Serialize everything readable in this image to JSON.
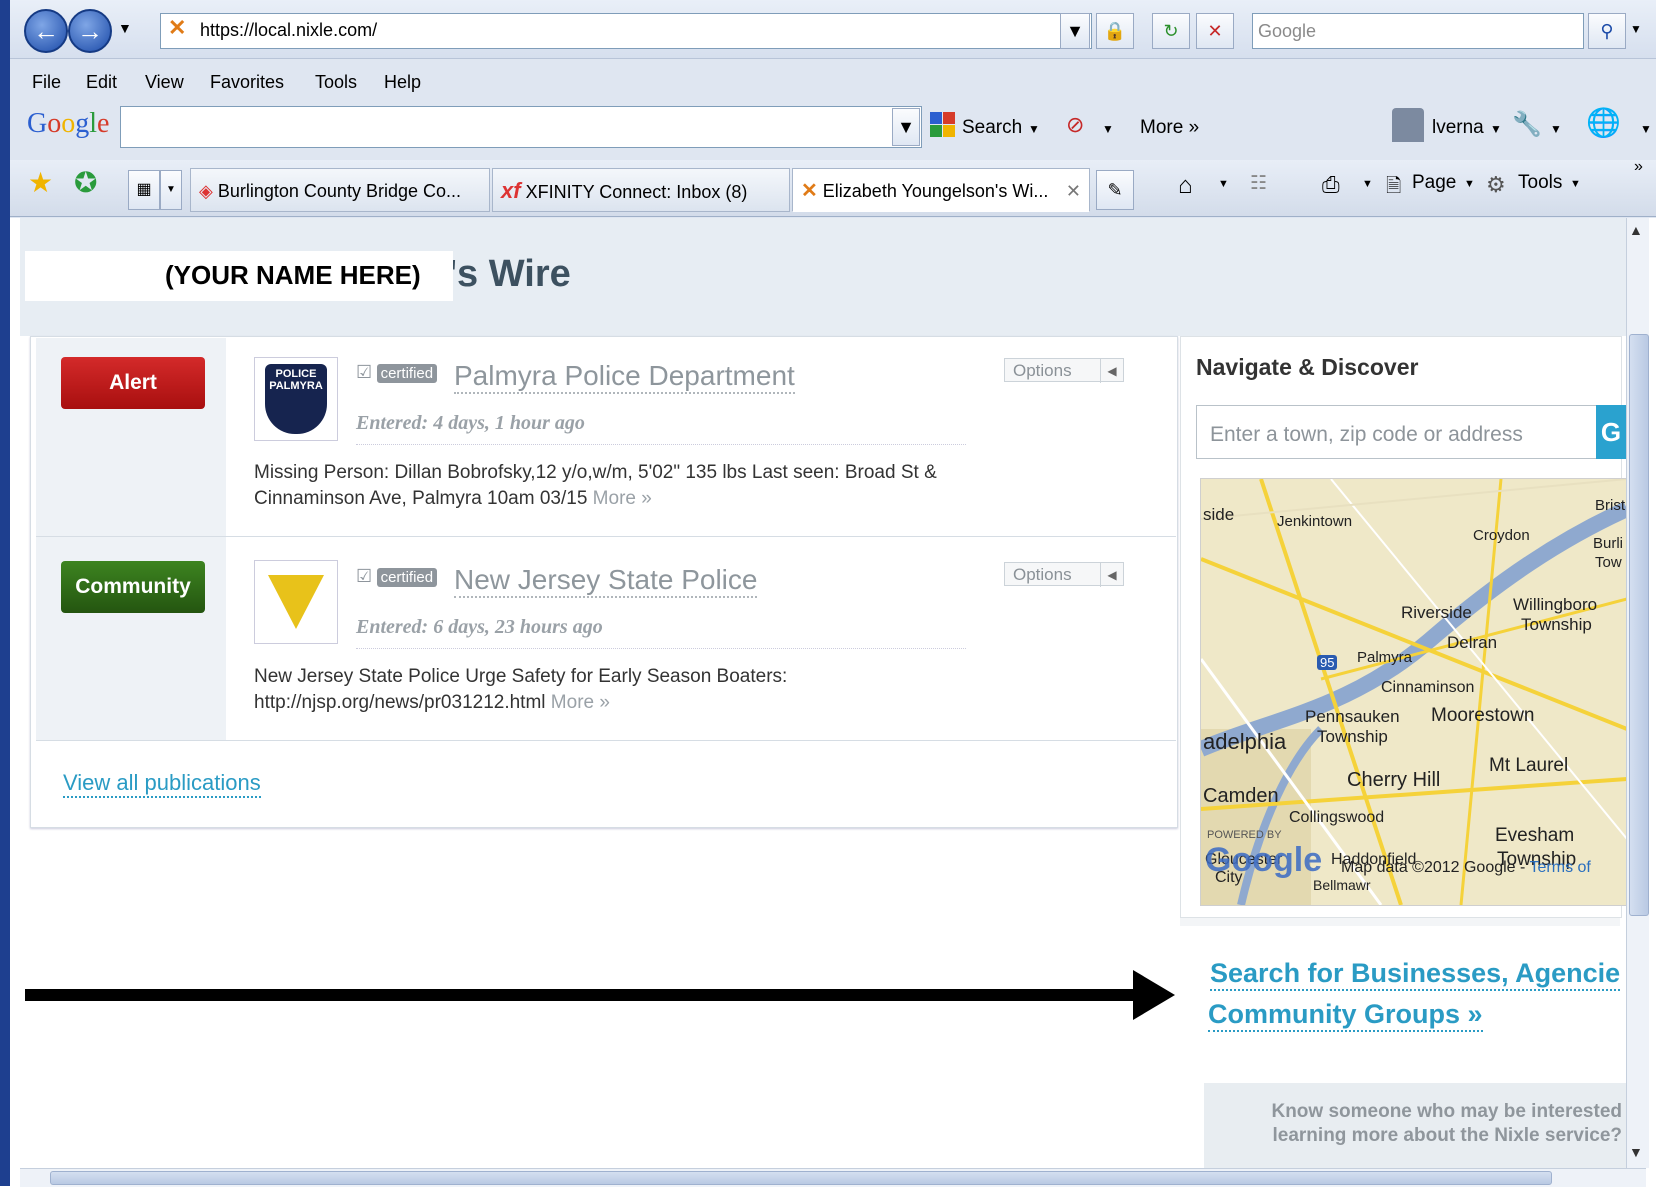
{
  "browser": {
    "url": "https://local.nixle.com/",
    "search_placeholder": "Google",
    "menu": [
      "File",
      "Edit",
      "View",
      "Favorites",
      "Tools",
      "Help"
    ],
    "google_bar": {
      "logo": "Google",
      "search_label": "Search",
      "more_label": "More »",
      "user_label": "lverna"
    },
    "tabs": [
      {
        "label": "Burlington County Bridge Co..."
      },
      {
        "label": "XFINITY Connect: Inbox (8)"
      },
      {
        "label": "Elizabeth Youngelson's Wi..."
      }
    ],
    "command_bar": {
      "page_label": "Page",
      "tools_label": "Tools"
    }
  },
  "page": {
    "name_overlay": "(YOUR NAME HERE)",
    "title_suffix": "'s Wire",
    "posts": [
      {
        "badge": "Alert",
        "badge_color": "#c01818",
        "certified": "certified",
        "agency": "Palmyra Police Department",
        "entered": "Entered: 4 days, 1 hour ago",
        "message": "Missing Person: Dillan Bobrofsky,12 y/o,w/m, 5'02\" 135 lbs Last seen: Broad St & Cinnaminson Ave, Palmyra 10am 03/15",
        "more": "More »",
        "options": "Options",
        "logo_text": "POLICE PALMYRA NJ"
      },
      {
        "badge": "Community",
        "badge_color": "#2f6b14",
        "certified": "certified",
        "agency": "New Jersey State Police",
        "entered": "Entered: 6 days, 23 hours ago",
        "message": "New Jersey State Police Urge Safety for Early Season Boaters: http://njsp.org/news/pr031212.html",
        "more": "More »",
        "options": "Options"
      }
    ],
    "view_all": "View all publications",
    "sidebar": {
      "title": "Navigate & Discover",
      "town_placeholder": "Enter a town, zip code or address",
      "go_label": "G",
      "map_labels": [
        "Jenkintown",
        "Croydon",
        "Brist",
        "Burli",
        "Tow",
        "Willingboro",
        "Township",
        "Riverside",
        "Delran",
        "Palmyra",
        "Cinnaminson",
        "Pennsauken",
        "Township",
        "Moorestown",
        "adelphia",
        "Camden",
        "Cherry Hill",
        "Mt Laurel",
        "Collingswood",
        "Evesham",
        "Township",
        "Haddonfield",
        "Gloucester",
        "City",
        "Bellmawr",
        "side",
        "95"
      ],
      "map_powered": "POWERED BY",
      "map_google": "Google",
      "map_data": "Map data ©2012 Google - ",
      "map_terms": "Terms of",
      "search_businesses": "Search for Businesses, Agencie",
      "community_groups": "Community Groups »",
      "know_text": "Know someone who may be interested learning more about the Nixle service?"
    }
  }
}
